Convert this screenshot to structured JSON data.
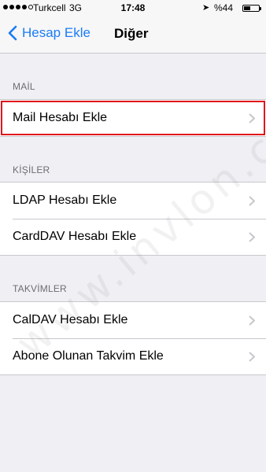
{
  "status_bar": {
    "carrier": "Turkcell",
    "network": "3G",
    "time": "17:48",
    "battery": "%44",
    "battery_level": 0.44,
    "icons": [
      "signal-dots-icon",
      "location-arrow-icon",
      "battery-icon"
    ]
  },
  "nav": {
    "back_label": "Hesap Ekle",
    "title": "Diğer",
    "back_color": "#1a7cf5"
  },
  "sections": [
    {
      "header": "MAİL",
      "rows": [
        {
          "label": "Mail Hesabı Ekle",
          "highlighted": true
        }
      ]
    },
    {
      "header": "KİŞİLER",
      "rows": [
        {
          "label": "LDAP Hesabı Ekle"
        },
        {
          "label": "CardDAV Hesabı Ekle"
        }
      ]
    },
    {
      "header": "TAKVİMLER",
      "rows": [
        {
          "label": "CalDAV Hesabı Ekle"
        },
        {
          "label": "Abone Olunan Takvim Ekle"
        }
      ]
    }
  ],
  "watermark": "www.invlon.com",
  "colors": {
    "highlight": "#e0161c",
    "background": "#efeff4"
  }
}
